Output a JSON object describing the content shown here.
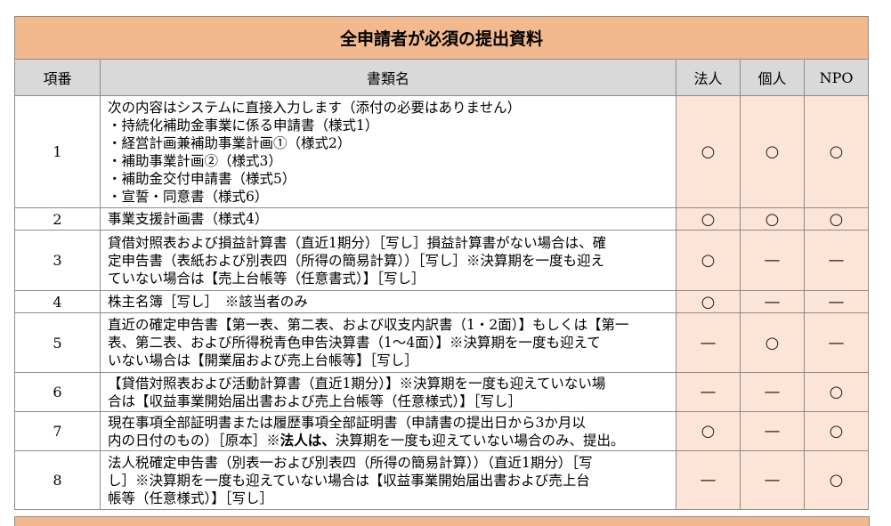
{
  "title": "全申請者が必須の提出資料",
  "headers": {
    "no": "項番",
    "name": "書類名",
    "corp": "法人",
    "indiv": "個人",
    "npo": "NPO"
  },
  "marks": {
    "yes": "○",
    "no": "—"
  },
  "rows": [
    {
      "no": "1",
      "lines": [
        "次の内容はシステムに直接入力します（添付の必要はありません）",
        "・持続化補助金事業に係る申請書（様式1）",
        "・経営計画兼補助事業計画①（様式2）",
        "・補助事業計画②（様式3）",
        "・補助金交付申請書（様式5）",
        "・宣誓・同意書（様式6）"
      ],
      "corp": "○",
      "indiv": "○",
      "npo": "○"
    },
    {
      "no": "2",
      "lines": [
        "事業支援計画書（様式4）"
      ],
      "corp": "○",
      "indiv": "○",
      "npo": "○"
    },
    {
      "no": "3",
      "lines": [
        "貸借対照表および損益計算書（直近1期分）［写し］損益計算書がない場合は、確",
        "定申告書（表紙および別表四（所得の簡易計算））［写し］※決算期を一度も迎え",
        "ていない場合は【売上台帳等（任意書式）】［写し］"
      ],
      "corp": "○",
      "indiv": "—",
      "npo": "—"
    },
    {
      "no": "4",
      "lines": [
        "株主名簿［写し］　※該当者のみ"
      ],
      "corp": "○",
      "indiv": "—",
      "npo": "—"
    },
    {
      "no": "5",
      "lines": [
        "直近の確定申告書【第一表、第二表、および収支内訳書（1・2面）】もしくは【第一",
        "表、第二表、および所得税青色申告決算書（1～4面）】※決算期を一度も迎えて",
        "いない場合は【開業届および売上台帳等】［写し］"
      ],
      "corp": "—",
      "indiv": "○",
      "npo": "—"
    },
    {
      "no": "6",
      "lines": [
        "【貸借対照表および活動計算書（直近1期分）】※決算期を一度も迎えていない場",
        "合は【収益事業開始届出書および売上台帳等（任意様式）】［写し］"
      ],
      "corp": "—",
      "indiv": "—",
      "npo": "○"
    },
    {
      "no": "7",
      "line1": "現在事項全部証明書または履歴事項全部証明書（申請書の提出日から3か月以",
      "line2_pre": "内の日付のもの）［原本］※",
      "line2_bold": "法人は、",
      "line2_post": "決算期を一度も迎えていない場合のみ、提出。",
      "corp": "○",
      "indiv": "—",
      "npo": "○"
    },
    {
      "no": "8",
      "lines": [
        "法人税確定申告書（別表一および別表四（所得の簡易計算））（直近1期分）［写",
        "し］※決算期を一度も迎えていない場合は【収益事業開始届出書および売上台",
        "帳等（任意様式）】［写し］"
      ],
      "corp": "—",
      "indiv": "—",
      "npo": "○"
    }
  ]
}
